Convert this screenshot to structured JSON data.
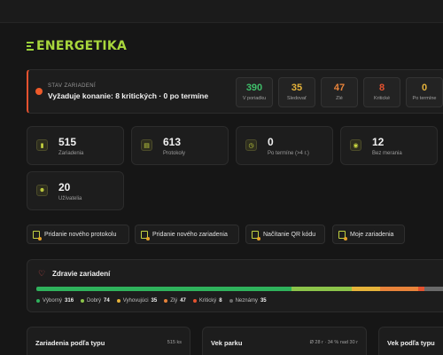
{
  "brand": {
    "name": "ENERGETIKA",
    "accent": "#a8d63c"
  },
  "status": {
    "label": "STAV ZARIADENÍ",
    "text": "Vyžaduje konanie: 8 kritických · 0 po termíne",
    "counters": [
      {
        "value": "390",
        "label": "V poriadku",
        "color": "#3fbf6a"
      },
      {
        "value": "35",
        "label": "Sledovať",
        "color": "#e6b33a"
      },
      {
        "value": "47",
        "label": "Zlé",
        "color": "#e8833a"
      },
      {
        "value": "8",
        "label": "Kritické",
        "color": "#e5522f"
      },
      {
        "value": "0",
        "label": "Po termíne",
        "color": "#e6b33a"
      }
    ]
  },
  "stats": [
    {
      "value": "515",
      "label": "Zariadenia",
      "icon": "device-icon"
    },
    {
      "value": "613",
      "label": "Protokoly",
      "icon": "document-icon"
    },
    {
      "value": "0",
      "label": "Po termíne (>4 r.)",
      "icon": "clock-icon"
    },
    {
      "value": "12",
      "label": "Bez merania",
      "icon": "meter-icon"
    },
    {
      "value": "20",
      "label": "Užívatelia",
      "icon": "users-icon"
    }
  ],
  "actions": [
    {
      "label": "Pridanie nového protokolu",
      "icon": "new-protocol-icon"
    },
    {
      "label": "Pridanie nového zariadenia",
      "icon": "new-device-icon"
    },
    {
      "label": "Načítanie QR kódu",
      "icon": "qr-scan-icon"
    },
    {
      "label": "Moje zariadenia",
      "icon": "my-devices-icon"
    }
  ],
  "health": {
    "title": "Zdravie zariadení",
    "legend": [
      {
        "name": "Výborný",
        "value": "316",
        "color": "#2fb25c"
      },
      {
        "name": "Dobrý",
        "value": "74",
        "color": "#8cc44a"
      },
      {
        "name": "Vyhovujúci",
        "value": "35",
        "color": "#e6b33a"
      },
      {
        "name": "Zlý",
        "value": "47",
        "color": "#e8833a"
      },
      {
        "name": "Kritický",
        "value": "8",
        "color": "#e5522f"
      },
      {
        "name": "Neznámy",
        "value": "35",
        "color": "#6a6a6a"
      }
    ]
  },
  "bottom": [
    {
      "title": "Zariadenia podľa typu",
      "right": "515 ks"
    },
    {
      "title": "Vek parku",
      "right": "Ø 28 r · 34 % nad 30 r"
    },
    {
      "title": "Vek podľa typu",
      "right": ""
    }
  ]
}
